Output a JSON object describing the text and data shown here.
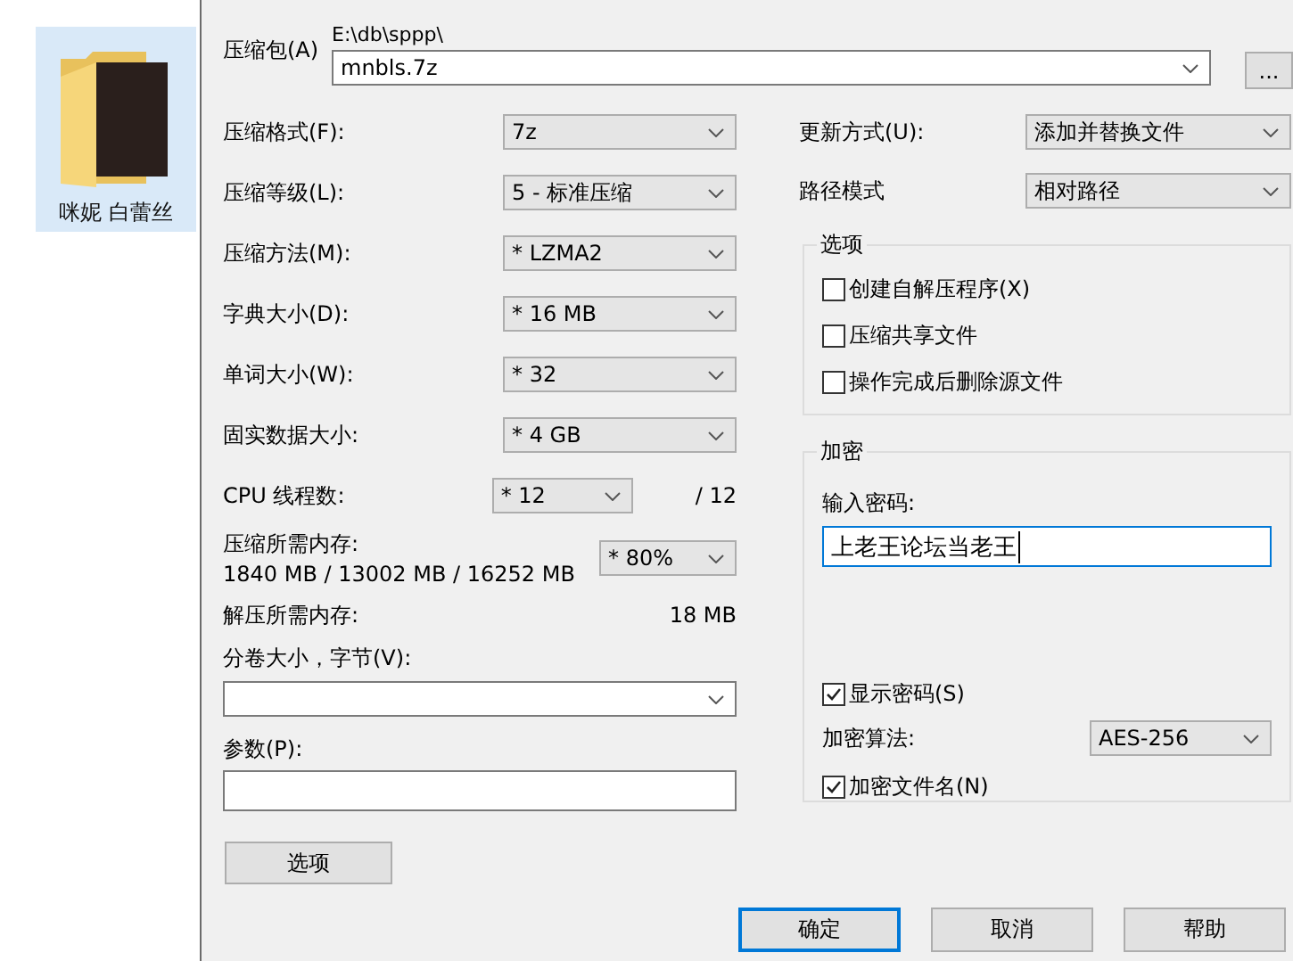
{
  "desktop": {
    "item": {
      "label": "咪妮 白蕾丝",
      "selected": true
    }
  },
  "archive": {
    "label": "压缩包(A)",
    "path": "E:\\db\\sppp\\",
    "value": "mnbls.7z",
    "browse": "..."
  },
  "left": {
    "settings": [
      {
        "label": "压缩格式(F):",
        "value": "7z"
      },
      {
        "label": "压缩等级(L):",
        "value": "5 - 标准压缩"
      },
      {
        "label": "压缩方法(M):",
        "value": "* LZMA2"
      },
      {
        "label": "字典大小(D):",
        "value": "* 16 MB"
      },
      {
        "label": "单词大小(W):",
        "value": "* 32"
      },
      {
        "label": "固实数据大小:",
        "value": "* 4 GB"
      }
    ],
    "cpu": {
      "label": "CPU 线程数:",
      "value": "* 12",
      "max": "/ 12"
    },
    "compress_memory": {
      "label": "压缩所需内存:",
      "detail": "1840 MB / 13002 MB / 16252 MB",
      "value": "* 80%"
    },
    "decompress_memory": {
      "label": "解压所需内存:",
      "value": "18 MB"
    },
    "volume": {
      "label": "分卷大小，字节(V):"
    },
    "parameters": {
      "label": "参数(P):"
    },
    "options_button": "选项"
  },
  "right": {
    "update": {
      "label": "更新方式(U):",
      "value": "添加并替换文件"
    },
    "path_mode": {
      "label": "路径模式",
      "value": "相对路径"
    },
    "options": {
      "title": "选项",
      "items": [
        {
          "label": "创建自解压程序(X)",
          "checked": false
        },
        {
          "label": "压缩共享文件",
          "checked": false
        },
        {
          "label": "操作完成后删除源文件",
          "checked": false
        }
      ]
    },
    "encryption": {
      "title": "加密",
      "password_label": "输入密码:",
      "password": "上老王论坛当老王",
      "show_password": {
        "label": "显示密码(S)",
        "checked": true
      },
      "method": {
        "label": "加密算法:",
        "value": "AES-256"
      },
      "encrypt_names": {
        "label": "加密文件名(N)",
        "checked": true
      }
    }
  },
  "buttons": [
    {
      "label": "确定",
      "default": true
    },
    {
      "label": "取消",
      "default": false
    },
    {
      "label": "帮助",
      "default": false
    }
  ]
}
